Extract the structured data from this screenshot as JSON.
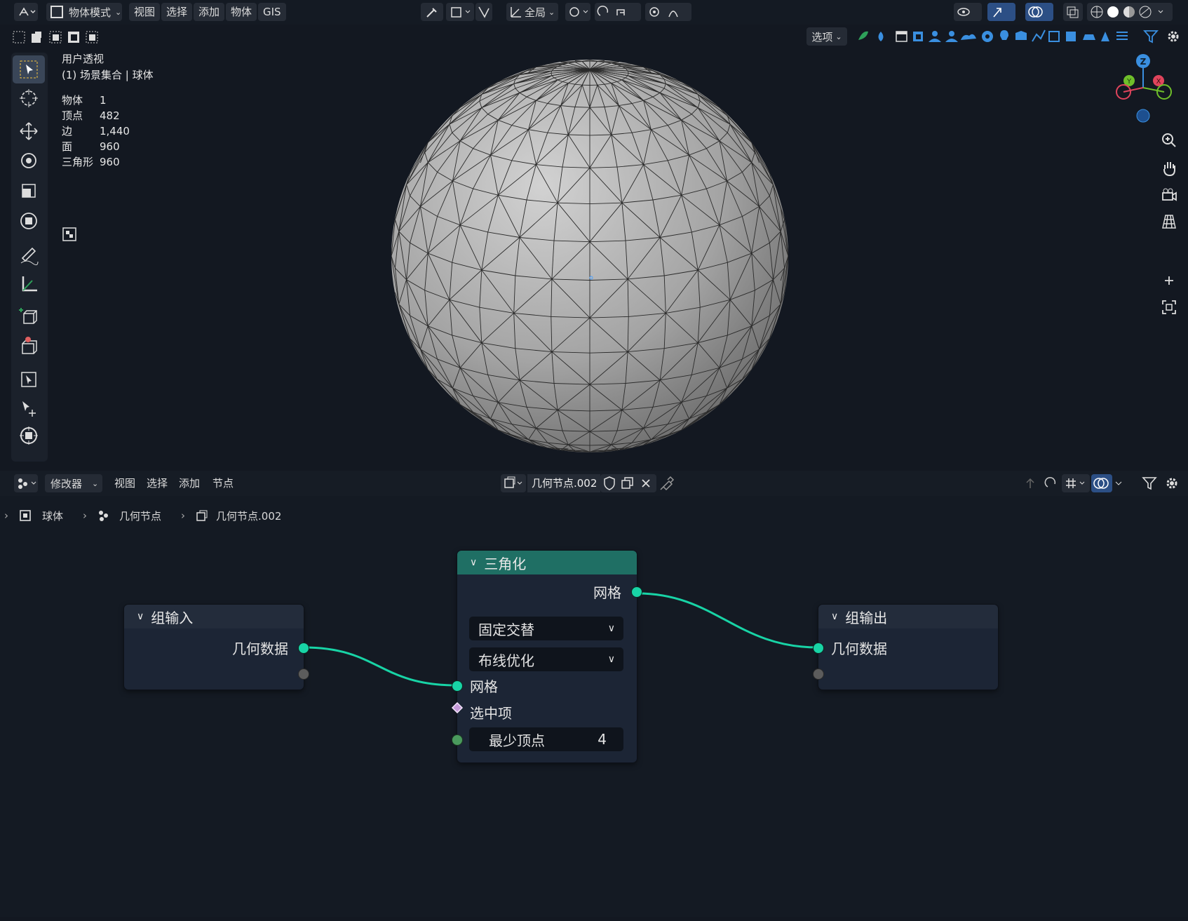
{
  "colors": {
    "accent_geo": "#18d4a6",
    "node_header_triangulate": "#1f6f64",
    "bg": "#131821"
  },
  "viewport_header": {
    "mode_label": "物体模式",
    "menus": [
      "视图",
      "选择",
      "添加",
      "物体",
      "GIS"
    ],
    "transform_orientation": "全局",
    "options_label": "选项"
  },
  "overlay": {
    "view_name": "用户透视",
    "collection_line": "(1) 场景集合 | 球体",
    "stats": [
      {
        "label": "物体",
        "value": "1"
      },
      {
        "label": "顶点",
        "value": "482"
      },
      {
        "label": "边",
        "value": "1,440"
      },
      {
        "label": "面",
        "value": "960"
      },
      {
        "label": "三角形",
        "value": "960"
      }
    ]
  },
  "gizmo": {
    "z_label": "Z",
    "y_label": "Y",
    "x_label": "X"
  },
  "node_header": {
    "editor_type_label": "修改器",
    "menus": [
      "视图",
      "选择",
      "添加",
      "节点"
    ],
    "node_tree_name": "几何节点.002"
  },
  "breadcrumb": {
    "items": [
      "球体",
      "几何节点",
      "几何节点.002"
    ]
  },
  "nodes": {
    "group_input": {
      "title": "组输入",
      "output_label": "几何数据"
    },
    "triangulate": {
      "title": "三角化",
      "output_label": "网格",
      "quad_method": "固定交替",
      "ngon_method": "布线优化",
      "input_mesh": "网格",
      "input_selection": "选中项",
      "min_vertices_label": "最少顶点",
      "min_vertices_value": "4"
    },
    "group_output": {
      "title": "组输出",
      "input_label": "几何数据"
    }
  }
}
